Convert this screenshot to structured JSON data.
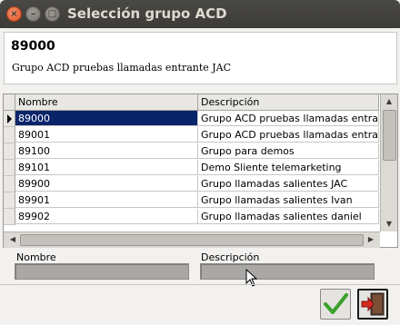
{
  "window": {
    "title": "Selección grupo ACD",
    "close_glyph": "×",
    "min_glyph": "–",
    "max_glyph": "□"
  },
  "header": {
    "code": "89000",
    "description": "Grupo ACD pruebas llamadas entrante JAC"
  },
  "grid": {
    "columns": [
      "Nombre",
      "Descripción"
    ],
    "selected_index": 0,
    "rows": [
      {
        "nombre": "89000",
        "descripcion": "Grupo ACD pruebas llamadas entrant"
      },
      {
        "nombre": "89001",
        "descripcion": "Grupo ACD pruebas llamadas entrant"
      },
      {
        "nombre": "89100",
        "descripcion": "Grupo para demos"
      },
      {
        "nombre": "89101",
        "descripcion": "Demo Sliente telemarketing"
      },
      {
        "nombre": "89900",
        "descripcion": "Grupo llamadas salientes JAC"
      },
      {
        "nombre": "89901",
        "descripcion": "Grupo llamadas salientes Ivan"
      },
      {
        "nombre": "89902",
        "descripcion": "Grupo llamadas salientes daniel"
      }
    ]
  },
  "filters": {
    "nombre_label": "Nombre",
    "nombre_value": "",
    "descripcion_label": "Descripción",
    "descripcion_value": ""
  },
  "colors": {
    "selection": "#0a246a",
    "ok_check": "#3aa12b",
    "exit_arrow": "#d42a1f"
  },
  "icons": {
    "ok": "checkmark-icon",
    "exit": "exit-door-icon"
  }
}
